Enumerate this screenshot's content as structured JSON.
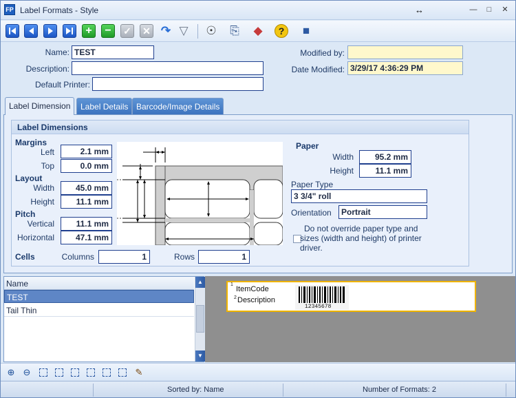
{
  "window": {
    "title": "Label Formats - Style",
    "minimize": "—",
    "maximize": "□",
    "close": "✕",
    "app_icon_text": "FP"
  },
  "toolbar": {
    "buttons": [
      {
        "name": "first-record-button",
        "icon": "first-icon"
      },
      {
        "name": "previous-record-button",
        "icon": "previous-icon"
      },
      {
        "name": "next-record-button",
        "icon": "next-icon"
      },
      {
        "name": "last-record-button",
        "icon": "last-icon"
      },
      {
        "name": "add-record-button",
        "icon": "plus-icon",
        "glyph": "+"
      },
      {
        "name": "delete-record-button",
        "icon": "minus-icon",
        "glyph": "−"
      },
      {
        "name": "save-record-button",
        "icon": "check-icon",
        "glyph": "✓"
      },
      {
        "name": "cancel-edit-button",
        "icon": "x-icon",
        "glyph": "✕"
      },
      {
        "name": "refresh-button",
        "icon": "refresh-icon",
        "glyph": "↷"
      },
      {
        "name": "filter-button",
        "icon": "funnel-icon",
        "glyph": "▽"
      },
      {
        "name": "find-button",
        "icon": "binoculars-icon",
        "glyph": "☉"
      },
      {
        "name": "copy-button",
        "icon": "copy-icon",
        "glyph": "⎘"
      },
      {
        "name": "label-button",
        "icon": "tag-icon",
        "glyph": "◆"
      },
      {
        "name": "help-button",
        "icon": "help-icon",
        "glyph": "?"
      },
      {
        "name": "exit-button",
        "icon": "exit-door-icon",
        "glyph": "■"
      }
    ]
  },
  "form": {
    "name_label": "Name:",
    "name_value": "TEST",
    "description_label": "Description:",
    "description_value": "",
    "default_printer_label": "Default Printer:",
    "default_printer_value": "",
    "modified_by_label": "Modified by:",
    "modified_by_value": "",
    "date_modified_label": "Date Modified:",
    "date_modified_value": "3/29/17 4:36:29 PM"
  },
  "tabs": [
    {
      "label": "Label Dimension",
      "active": true
    },
    {
      "label": "Label Details",
      "active": false
    },
    {
      "label": "Barcode/Image Details",
      "active": false
    }
  ],
  "label_dimensions": {
    "group_title": "Label Dimensions",
    "margins_title": "Margins",
    "left_label": "Left",
    "left_value": "2.1 mm",
    "top_label": "Top",
    "top_value": "0.0 mm",
    "layout_title": "Layout",
    "width_label": "Width",
    "width_value": "45.0 mm",
    "height_label": "Height",
    "height_value": "11.1 mm",
    "pitch_title": "Pitch",
    "vertical_label": "Vertical",
    "vertical_value": "11.1 mm",
    "horizontal_label": "Horizontal",
    "horizontal_value": "47.1 mm",
    "cells_title": "Cells",
    "columns_label": "Columns",
    "columns_value": "1",
    "rows_label": "Rows",
    "rows_value": "1"
  },
  "paper": {
    "title": "Paper",
    "width_label": "Width",
    "width_value": "95.2 mm",
    "height_label": "Height",
    "height_value": "11.1 mm",
    "paper_type_label": "Paper Type",
    "paper_type_value": "3 3/4\" roll",
    "orientation_label": "Orientation",
    "orientation_value": "Portrait",
    "override_checkbox_label_line1": "Do not override paper type and",
    "override_checkbox_label_line2": "sizes (width and height) of printer",
    "override_checkbox_label_line3": "driver.",
    "override_checked": false
  },
  "list": {
    "column_header": "Name",
    "rows": [
      {
        "name": "TEST",
        "selected": true
      },
      {
        "name": "Tail Thin",
        "selected": false
      }
    ]
  },
  "preview": {
    "line1_marker": "1",
    "line1_text": "ItemCode",
    "line2_marker": "2",
    "line2_text": "Description",
    "barcode_number": "12345678"
  },
  "bottom_toolbar": {
    "buttons": [
      {
        "name": "zoom-in-button",
        "icon": "zoom-in-icon",
        "glyph": "⊕"
      },
      {
        "name": "zoom-out-button",
        "icon": "zoom-out-icon",
        "glyph": "⊖"
      },
      {
        "name": "grid-1-button",
        "icon": "grid-icon"
      },
      {
        "name": "grid-2-button",
        "icon": "grid-icon"
      },
      {
        "name": "grid-3-button",
        "icon": "grid-icon"
      },
      {
        "name": "grid-4-button",
        "icon": "grid-icon"
      },
      {
        "name": "grid-5-button",
        "icon": "grid-icon"
      },
      {
        "name": "grid-6-button",
        "icon": "grid-icon"
      },
      {
        "name": "edit-button",
        "icon": "edit-pencil-icon",
        "glyph": "✎"
      }
    ]
  },
  "status": {
    "sorted_by": "Sorted by: Name",
    "count": "Number of Formats: 2"
  }
}
